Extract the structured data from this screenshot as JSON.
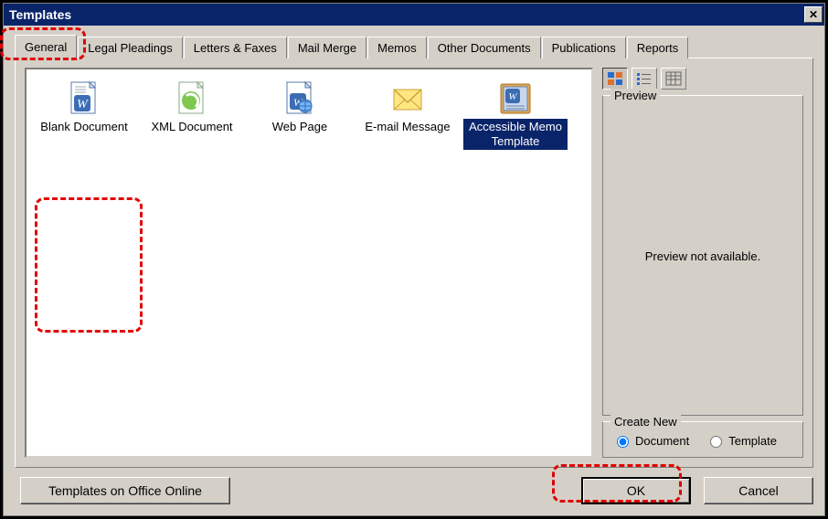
{
  "window": {
    "title": "Templates"
  },
  "tabs": [
    {
      "label": "General",
      "active": true
    },
    {
      "label": "Legal Pleadings"
    },
    {
      "label": "Letters & Faxes"
    },
    {
      "label": "Mail Merge"
    },
    {
      "label": "Memos"
    },
    {
      "label": "Other Documents"
    },
    {
      "label": "Publications"
    },
    {
      "label": "Reports"
    }
  ],
  "templates": [
    {
      "name": "Blank Document",
      "icon": "word-doc"
    },
    {
      "name": "XML Document",
      "icon": "xml-doc"
    },
    {
      "name": "Web Page",
      "icon": "web-page"
    },
    {
      "name": "E-mail Message",
      "icon": "email"
    },
    {
      "name": "Accessible Memo Template",
      "icon": "word-template",
      "selected": true
    }
  ],
  "view_icons": [
    "large-icons",
    "list",
    "details"
  ],
  "preview": {
    "title": "Preview",
    "text": "Preview not available."
  },
  "create_new": {
    "title": "Create New",
    "options": [
      {
        "label": "Document",
        "checked": true
      },
      {
        "label": "Template",
        "checked": false
      }
    ]
  },
  "buttons": {
    "office_online": "Templates on Office Online",
    "ok": "OK",
    "cancel": "Cancel"
  },
  "highlights": [
    "tab-general",
    "template-accessible-memo",
    "ok-button"
  ]
}
